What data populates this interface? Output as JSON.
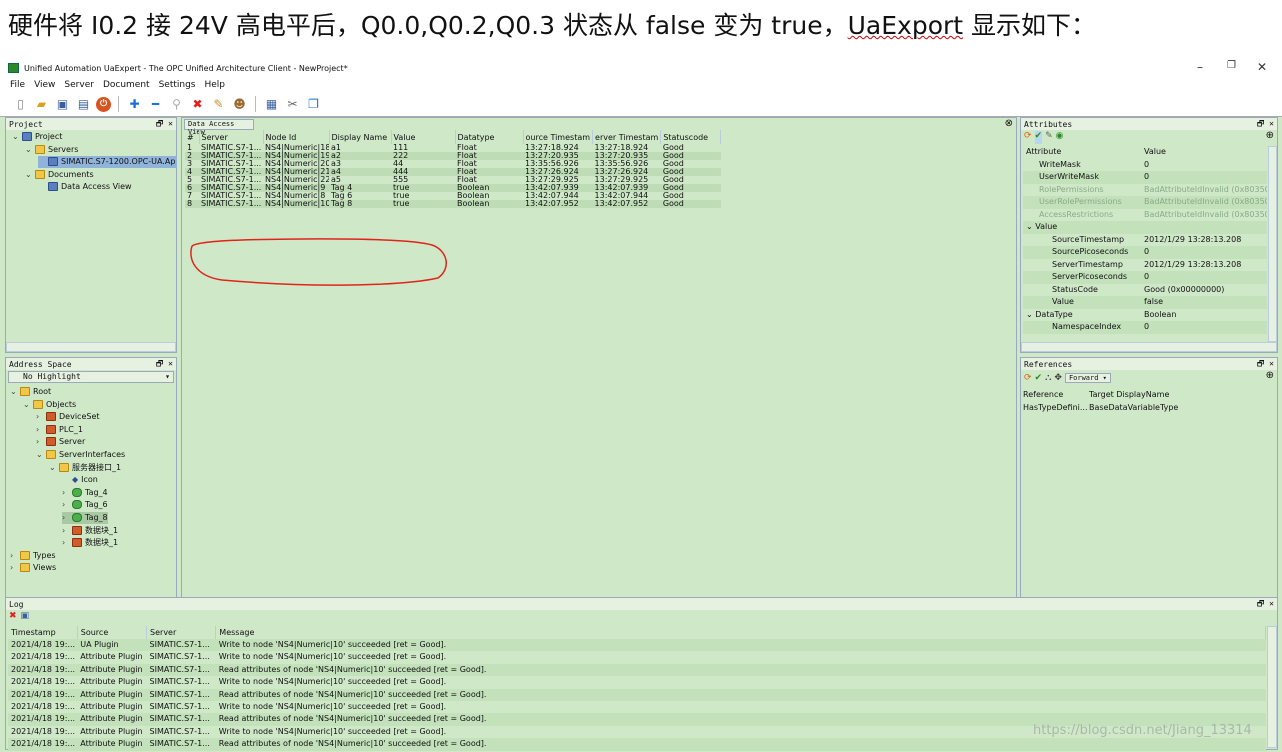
{
  "caption": {
    "prefix": "硬件将 I0.2 接 24V 高电平后，Q0.0,Q0.2,Q0.3 状态从 false 变为 true，",
    "ua": "UaExport",
    "suffix": " 显示如下："
  },
  "window": {
    "title": "Unified Automation UaExpert - The OPC Unified Architecture Client - NewProject*"
  },
  "menu": [
    "File",
    "View",
    "Server",
    "Document",
    "Settings",
    "Help"
  ],
  "toolbar_icons": [
    "new-icon",
    "open-icon",
    "save-icon",
    "save-as-icon",
    "close-icon",
    "add-icon",
    "remove-icon",
    "connect-icon",
    "disconnect-icon",
    "settings-icon",
    "user-icon",
    "info-icon",
    "cut-icon",
    "window-icon"
  ],
  "project": {
    "title": "Project",
    "items": [
      {
        "label": "Project",
        "level": 0,
        "icon": "project"
      },
      {
        "label": "Servers",
        "level": 1,
        "icon": "folder"
      },
      {
        "label": "SIMATIC.S7-1200.OPC-UA.Ap",
        "level": 2,
        "icon": "server",
        "selected": true
      },
      {
        "label": "Documents",
        "level": 1,
        "icon": "folder"
      },
      {
        "label": "Data Access View",
        "level": 2,
        "icon": "doc"
      }
    ]
  },
  "address": {
    "title": "Address Space",
    "highlight": "No Highlight",
    "items": [
      {
        "label": "Root",
        "level": 0,
        "icon": "fold"
      },
      {
        "label": "Objects",
        "level": 1,
        "icon": "fold"
      },
      {
        "label": "DeviceSet",
        "level": 2,
        "icon": "cube"
      },
      {
        "label": "PLC_1",
        "level": 2,
        "icon": "cube"
      },
      {
        "label": "Server",
        "level": 2,
        "icon": "cube"
      },
      {
        "label": "ServerInterfaces",
        "level": 2,
        "icon": "fold"
      },
      {
        "label": "服务器接口_1",
        "level": 3,
        "icon": "fold"
      },
      {
        "label": "Icon",
        "level": 4,
        "icon": "dot"
      },
      {
        "label": "Tag_4",
        "level": 4,
        "icon": "tag"
      },
      {
        "label": "Tag_6",
        "level": 4,
        "icon": "tag"
      },
      {
        "label": "Tag_8",
        "level": 4,
        "icon": "tag",
        "selected": true
      },
      {
        "label": "数据块_1",
        "level": 4,
        "icon": "cube"
      },
      {
        "label": "数据块_1",
        "level": 4,
        "icon": "cube"
      },
      {
        "label": "Types",
        "level": 0,
        "icon": "fold"
      },
      {
        "label": "Views",
        "level": 0,
        "icon": "fold"
      }
    ]
  },
  "dav": {
    "tab": "Data Access View",
    "columns": [
      "#",
      "Server",
      "Node Id",
      "Display Name",
      "Value",
      "Datatype",
      "ource Timestam",
      "erver Timestam",
      "Statuscode"
    ],
    "rows": [
      [
        "1",
        "SIMATIC.S7-1...",
        "NS4|Numeric|18",
        "a1",
        "111",
        "Float",
        "13:27:18.924",
        "13:27:18.924",
        "Good"
      ],
      [
        "2",
        "SIMATIC.S7-1...",
        "NS4|Numeric|19",
        "a2",
        "222",
        "Float",
        "13:27:20.935",
        "13:27:20.935",
        "Good"
      ],
      [
        "3",
        "SIMATIC.S7-1...",
        "NS4|Numeric|20",
        "a3",
        "44",
        "Float",
        "13:35:56.926",
        "13:35:56.926",
        "Good"
      ],
      [
        "4",
        "SIMATIC.S7-1...",
        "NS4|Numeric|21",
        "a4",
        "444",
        "Float",
        "13:27:26.924",
        "13:27:26.924",
        "Good"
      ],
      [
        "5",
        "SIMATIC.S7-1...",
        "NS4|Numeric|22",
        "a5",
        "555",
        "Float",
        "13:27:29.925",
        "13:27:29.925",
        "Good"
      ],
      [
        "6",
        "SIMATIC.S7-1...",
        "NS4|Numeric|9",
        "Tag 4",
        "true",
        "Boolean",
        "13:42:07.939",
        "13:42:07.939",
        "Good"
      ],
      [
        "7",
        "SIMATIC.S7-1...",
        "NS4|Numeric|8",
        "Tag 6",
        "true",
        "Boolean",
        "13:42:07.944",
        "13:42:07.944",
        "Good"
      ],
      [
        "8",
        "SIMATIC.S7-1...",
        "NS4|Numeric|10",
        "Tag 8",
        "true",
        "Boolean",
        "13:42:07.952",
        "13:42:07.952",
        "Good"
      ]
    ]
  },
  "attributes": {
    "title": "Attributes",
    "columns": [
      "Attribute",
      "Value"
    ],
    "rows": [
      {
        "k": "WriteMask",
        "v": "0",
        "lvl": 1
      },
      {
        "k": "UserWriteMask",
        "v": "0",
        "lvl": 1
      },
      {
        "k": "RolePermissions",
        "v": "BadAttributeIdInvalid (0x8035000",
        "lvl": 1,
        "dim": true
      },
      {
        "k": "UserRolePermissions",
        "v": "BadAttributeIdInvalid (0x8035000",
        "lvl": 1,
        "dim": true
      },
      {
        "k": "AccessRestrictions",
        "v": "BadAttributeIdInvalid (0x8035000",
        "lvl": 1,
        "dim": true
      },
      {
        "k": "Value",
        "v": "",
        "lvl": 0,
        "exp": true
      },
      {
        "k": "SourceTimestamp",
        "v": "2012/1/29 13:28:13.208",
        "lvl": 2
      },
      {
        "k": "SourcePicoseconds",
        "v": "0",
        "lvl": 2
      },
      {
        "k": "ServerTimestamp",
        "v": "2012/1/29 13:28:13.208",
        "lvl": 2
      },
      {
        "k": "ServerPicoseconds",
        "v": "0",
        "lvl": 2
      },
      {
        "k": "StatusCode",
        "v": "Good (0x00000000)",
        "lvl": 2
      },
      {
        "k": "Value",
        "v": "false",
        "lvl": 2
      },
      {
        "k": "DataType",
        "v": "Boolean",
        "lvl": 0,
        "exp": true
      },
      {
        "k": "NamespaceIndex",
        "v": "0",
        "lvl": 2
      }
    ]
  },
  "references": {
    "title": "References",
    "direction": "Forward",
    "columns": [
      "Reference",
      "Target DisplayName"
    ],
    "rows": [
      [
        "HasTypeDefini...",
        "BaseDataVariableType"
      ]
    ]
  },
  "log": {
    "title": "Log",
    "columns": [
      "Timestamp",
      "Source",
      "Server",
      "Message"
    ],
    "rows": [
      [
        "2021/4/18 19:...",
        "UA Plugin",
        "SIMATIC.S7-1...",
        "Write to node 'NS4|Numeric|10' succeeded [ret = Good]."
      ],
      [
        "2021/4/18 19:...",
        "Attribute Plugin",
        "SIMATIC.S7-1...",
        "Write to node 'NS4|Numeric|10' succeeded [ret = Good]."
      ],
      [
        "2021/4/18 19:...",
        "Attribute Plugin",
        "SIMATIC.S7-1...",
        "Read attributes of node 'NS4|Numeric|10' succeeded [ret = Good]."
      ],
      [
        "2021/4/18 19:...",
        "Attribute Plugin",
        "SIMATIC.S7-1...",
        "Write to node 'NS4|Numeric|10' succeeded [ret = Good]."
      ],
      [
        "2021/4/18 19:...",
        "Attribute Plugin",
        "SIMATIC.S7-1...",
        "Read attributes of node 'NS4|Numeric|10' succeeded [ret = Good]."
      ],
      [
        "2021/4/18 19:...",
        "Attribute Plugin",
        "SIMATIC.S7-1...",
        "Write to node 'NS4|Numeric|10' succeeded [ret = Good]."
      ],
      [
        "2021/4/18 19:...",
        "Attribute Plugin",
        "SIMATIC.S7-1...",
        "Read attributes of node 'NS4|Numeric|10' succeeded [ret = Good]."
      ],
      [
        "2021/4/18 19:...",
        "Attribute Plugin",
        "SIMATIC.S7-1...",
        "Write to node 'NS4|Numeric|10' succeeded [ret = Good]."
      ],
      [
        "2021/4/18 19:...",
        "Attribute Plugin",
        "SIMATIC.S7-1...",
        "Read attributes of node 'NS4|Numeric|10' succeeded [ret = Good]."
      ]
    ]
  },
  "watermark": "https://blog.csdn.net/Jiang_13314",
  "colors": {
    "panel": "#cfe8c8",
    "annotation": "#e0241b"
  }
}
